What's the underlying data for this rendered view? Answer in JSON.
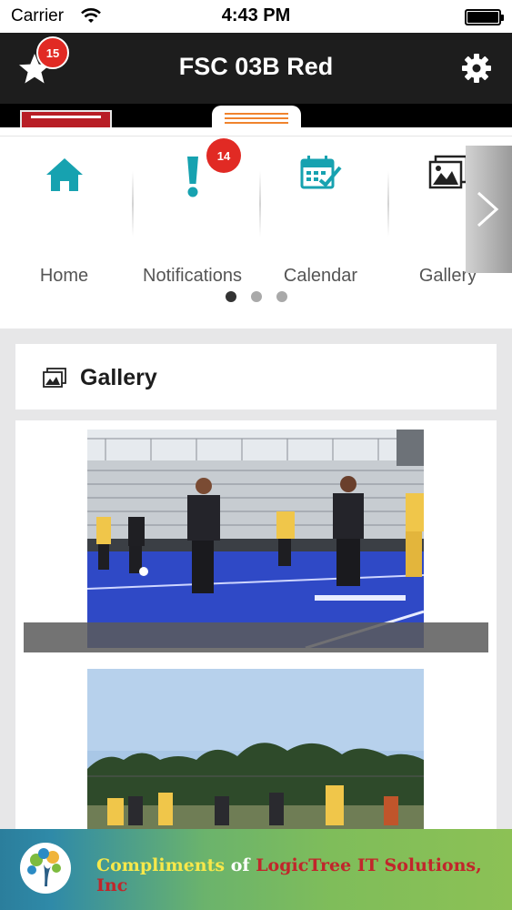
{
  "status_bar": {
    "carrier": "Carrier",
    "time": "4:43 PM"
  },
  "nav_bar": {
    "title": "FSC 03B Red",
    "favorites_badge": "15",
    "left_icon": "star-icon",
    "right_icon": "gear-icon"
  },
  "quick_nav": {
    "items": [
      {
        "label": "Home",
        "icon": "home-icon"
      },
      {
        "label": "Notifications",
        "icon": "exclamation-icon",
        "badge": "14"
      },
      {
        "label": "Calendar",
        "icon": "calendar-icon"
      },
      {
        "label": "Gallery",
        "icon": "gallery-icon"
      }
    ],
    "page_count": 3,
    "current_page": 1
  },
  "gallery": {
    "title": "Gallery",
    "icon": "gallery-icon"
  },
  "footer_ad": {
    "text_part1": "Compliments",
    "text_part2": " of ",
    "text_part3": "LogicTree IT Solutions, Inc"
  },
  "colors": {
    "nav_bar_bg": "#1d1d1d",
    "accent_teal": "#17a2b0",
    "badge_red": "#e12a24"
  }
}
